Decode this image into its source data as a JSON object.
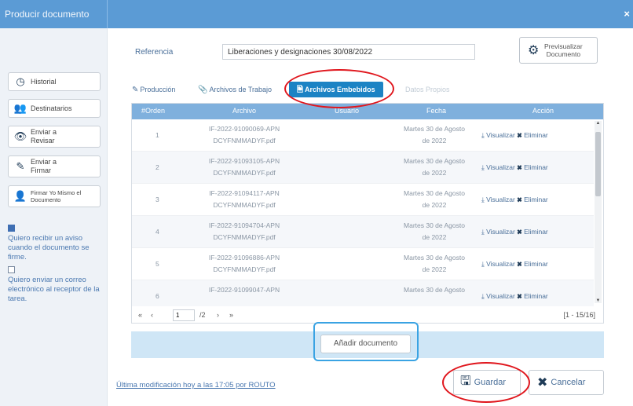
{
  "window": {
    "title": "Producir documento",
    "close_glyph": "×"
  },
  "sidebar": {
    "buttons": [
      {
        "label": "Historial",
        "icon": "clock-icon",
        "glyph": "◷"
      },
      {
        "label": "Destinatarios",
        "icon": "users-icon",
        "glyph": "👥"
      },
      {
        "label": "Enviar a Revisar",
        "icon": "eye-icon",
        "glyph": "👁"
      },
      {
        "label": "Enviar a Firmar",
        "icon": "edit-icon",
        "glyph": "✎"
      },
      {
        "label": "Firmar Yo Mismo el Documento",
        "icon": "user-icon",
        "glyph": "👤"
      }
    ],
    "notify_label": "Quiero recibir un aviso cuando el documento se firme.",
    "email_label": "Quiero enviar un correo electrónico al receptor de la tarea."
  },
  "form": {
    "reference_label": "Referencia",
    "reference_value": "Liberaciones y designaciones 30/08/2022",
    "preview_label": "Previsualizar Documento"
  },
  "tabs": [
    {
      "label": "Producción",
      "icon": "pencil-icon",
      "glyph": "✎"
    },
    {
      "label": "Archivos de Trabajo",
      "icon": "paperclip-icon",
      "glyph": "📎"
    },
    {
      "label": "Archivos Embebidos",
      "icon": "file-icon",
      "glyph": "🗎"
    },
    {
      "label": "Datos Propios",
      "icon": "list-icon",
      "glyph": ""
    }
  ],
  "table": {
    "headers": [
      "#Orden",
      "Archivo",
      "Usuario",
      "Fecha",
      "Acción"
    ],
    "rows": [
      {
        "num": "1",
        "file_line1": "IF-2022-91090069-APN",
        "file_line2": "DCYFNMMADYF.pdf",
        "date_line1": "Martes 30 de Agosto",
        "date_line2": "de 2022"
      },
      {
        "num": "2",
        "file_line1": "IF-2022-91093105-APN",
        "file_line2": "DCYFNMMADYF.pdf",
        "date_line1": "Martes 30 de Agosto",
        "date_line2": "de 2022"
      },
      {
        "num": "3",
        "file_line1": "IF-2022-91094117-APN",
        "file_line2": "DCYFNMMADYF.pdf",
        "date_line1": "Martes 30 de Agosto",
        "date_line2": "de 2022"
      },
      {
        "num": "4",
        "file_line1": "IF-2022-91094704-APN",
        "file_line2": "DCYFNMMADYF.pdf",
        "date_line1": "Martes 30 de Agosto",
        "date_line2": "de 2022"
      },
      {
        "num": "5",
        "file_line1": "IF-2022-91096886-APN",
        "file_line2": "DCYFNMMADYF.pdf",
        "date_line1": "Martes 30 de Agosto",
        "date_line2": "de 2022"
      },
      {
        "num": "6",
        "file_line1": "IF-2022-91099047-APN",
        "file_line2": "",
        "date_line1": "Martes 30 de Agosto",
        "date_line2": ""
      }
    ],
    "action_view": "Visualizar",
    "action_delete": "Eliminar",
    "pager_page": "1",
    "pager_total": "/2",
    "pager_range": "[1 - 15/16]"
  },
  "add_document_label": "Añadir documento",
  "last_modified": "Última modificación hoy a las 17:05 por ROUTO",
  "save_label": "Guardar",
  "cancel_label": "Cancelar",
  "colors": {
    "titlebar": "#5b9bd5",
    "active_tab": "#1c83c4",
    "table_header": "#7fb0dd",
    "highlight_red": "#e0161d",
    "highlight_blue": "#3aa3e3"
  }
}
